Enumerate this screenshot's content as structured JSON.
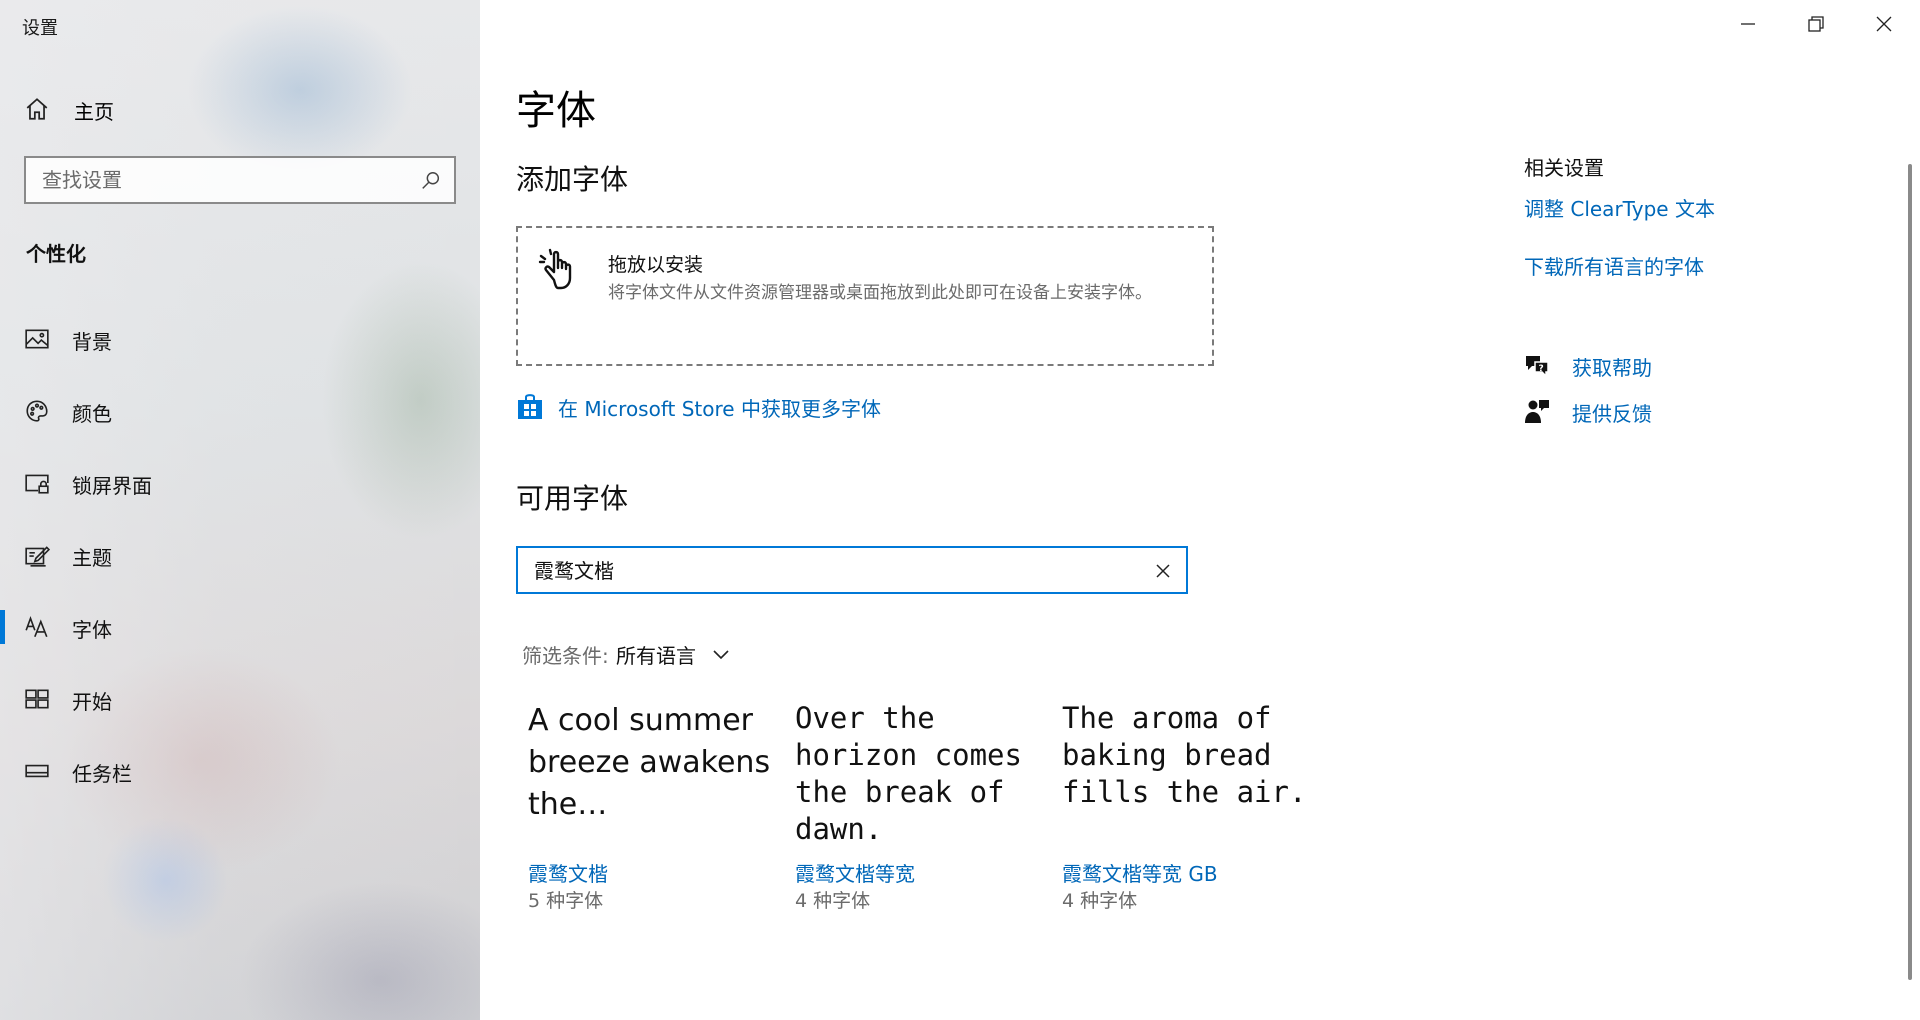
{
  "window": {
    "app_title": "设置",
    "controls": {
      "minimize": "minimize-icon",
      "restore": "restore-icon",
      "close": "close-icon"
    }
  },
  "sidebar": {
    "home_label": "主页",
    "search_placeholder": "查找设置",
    "section_title": "个性化",
    "items": [
      {
        "label": "背景",
        "icon": "picture-icon",
        "active": false
      },
      {
        "label": "颜色",
        "icon": "palette-icon",
        "active": false
      },
      {
        "label": "锁屏界面",
        "icon": "lock-screen-icon",
        "active": false
      },
      {
        "label": "主题",
        "icon": "theme-icon",
        "active": false
      },
      {
        "label": "字体",
        "icon": "font-icon",
        "active": true
      },
      {
        "label": "开始",
        "icon": "start-icon",
        "active": false
      },
      {
        "label": "任务栏",
        "icon": "taskbar-icon",
        "active": false
      }
    ]
  },
  "main": {
    "title": "字体",
    "add_fonts": {
      "heading": "添加字体",
      "drop_title": "拖放以安装",
      "drop_desc": "将字体文件从文件资源管理器或桌面拖放到此处即可在设备上安装字体。",
      "store_link": "在 Microsoft Store 中获取更多字体"
    },
    "available_fonts": {
      "heading": "可用字体",
      "search_value": "霞鹜文楷",
      "filter_label": "筛选条件:",
      "filter_value": "所有语言",
      "cards": [
        {
          "preview": "A cool summer breeze awakens the…",
          "name": "霞鹜文楷",
          "count": "5 种字体"
        },
        {
          "preview": "Over the horizon comes the break of dawn.",
          "name": "霞鹜文楷等宽",
          "count": "4 种字体"
        },
        {
          "preview": "The aroma of baking bread fills the air.",
          "name": "霞鹜文楷等宽 GB",
          "count": "4 种字体"
        }
      ]
    }
  },
  "related": {
    "title": "相关设置",
    "links": [
      "调整 ClearType 文本",
      "下载所有语言的字体"
    ],
    "help": "获取帮助",
    "feedback": "提供反馈"
  },
  "colors": {
    "accent": "#0078d7",
    "link": "#0067b8",
    "secondary_text": "#6b6b6b"
  }
}
